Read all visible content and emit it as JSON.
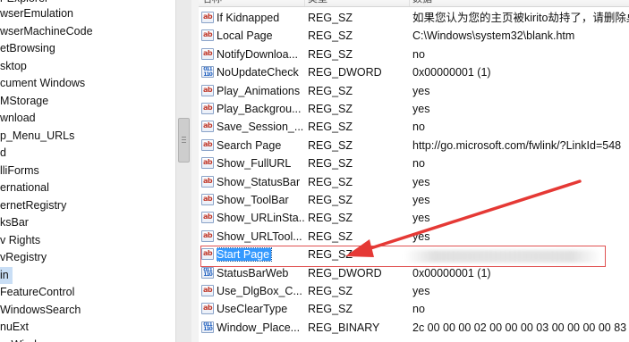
{
  "tree": {
    "items": [
      {
        "label": "wserEmulation"
      },
      {
        "label": "wserMachineCode"
      },
      {
        "label": "etBrowsing"
      },
      {
        "label": "sktop"
      },
      {
        "label": "cument Windows"
      },
      {
        "label": "MStorage"
      },
      {
        "label": "wnload"
      },
      {
        "label": "p_Menu_URLs"
      },
      {
        "label": "d"
      },
      {
        "label": "lliForms"
      },
      {
        "label": "ernational"
      },
      {
        "label": "ernetRegistry"
      },
      {
        "label": "ksBar"
      },
      {
        "label": "v Rights"
      },
      {
        "label": "vRegistry"
      },
      {
        "label": "in"
      },
      {
        "label": "FeatureControl"
      },
      {
        "label": "WindowsSearch"
      },
      {
        "label": "nuExt"
      },
      {
        "label": "---Wind---"
      }
    ],
    "top_partial_label": "r Explorer"
  },
  "list": {
    "headers": {
      "name": "名称",
      "type": "类型",
      "data": "数据"
    },
    "rows": [
      {
        "icon": "string-value-icon",
        "name": "If Kidnapped",
        "type": "REG_SZ",
        "data": "如果您认为您的主页被kirito劫持了，请删除桌面"
      },
      {
        "icon": "string-value-icon",
        "name": "Local Page",
        "type": "REG_SZ",
        "data": "C:\\Windows\\system32\\blank.htm"
      },
      {
        "icon": "string-value-icon",
        "name": "NotifyDownloa...",
        "type": "REG_SZ",
        "data": "no"
      },
      {
        "icon": "binary-value-icon",
        "name": "NoUpdateCheck",
        "type": "REG_DWORD",
        "data": "0x00000001 (1)"
      },
      {
        "icon": "string-value-icon",
        "name": "Play_Animations",
        "type": "REG_SZ",
        "data": "yes"
      },
      {
        "icon": "string-value-icon",
        "name": "Play_Backgrou...",
        "type": "REG_SZ",
        "data": "yes"
      },
      {
        "icon": "string-value-icon",
        "name": "Save_Session_...",
        "type": "REG_SZ",
        "data": "no"
      },
      {
        "icon": "string-value-icon",
        "name": "Search Page",
        "type": "REG_SZ",
        "data": "http://go.microsoft.com/fwlink/?LinkId=548"
      },
      {
        "icon": "string-value-icon",
        "name": "Show_FullURL",
        "type": "REG_SZ",
        "data": "no"
      },
      {
        "icon": "string-value-icon",
        "name": "Show_StatusBar",
        "type": "REG_SZ",
        "data": "yes"
      },
      {
        "icon": "string-value-icon",
        "name": "Show_ToolBar",
        "type": "REG_SZ",
        "data": "yes"
      },
      {
        "icon": "string-value-icon",
        "name": "Show_URLinSta...",
        "type": "REG_SZ",
        "data": "yes"
      },
      {
        "icon": "string-value-icon",
        "name": "Show_URLTool...",
        "type": "REG_SZ",
        "data": "yes"
      },
      {
        "icon": "string-value-icon",
        "name": "Start Page",
        "type": "REG_SZ",
        "data": ""
      },
      {
        "icon": "binary-value-icon",
        "name": "StatusBarWeb",
        "type": "REG_DWORD",
        "data": "0x00000001 (1)"
      },
      {
        "icon": "string-value-icon",
        "name": "Use_DlgBox_C...",
        "type": "REG_SZ",
        "data": "yes"
      },
      {
        "icon": "string-value-icon",
        "name": "UseClearType",
        "type": "REG_SZ",
        "data": "no"
      },
      {
        "icon": "binary-value-icon",
        "name": "Window_Place...",
        "type": "REG_BINARY",
        "data": "2c 00 00 00 02 00 00 00 03 00 00 00 00 83"
      }
    ]
  },
  "icons": {
    "string_glyph": "ab",
    "binary_glyph": "011\n110"
  },
  "colors": {
    "selection": "#3399ff",
    "highlight_box": "#e05252",
    "arrow": "#e53935"
  }
}
